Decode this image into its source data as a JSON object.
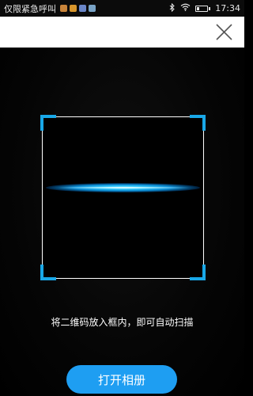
{
  "status_bar": {
    "carrier_text": "仅限紧急呼叫",
    "notification_icons": [
      {
        "name": "app-icon-1",
        "color": "#c8843a"
      },
      {
        "name": "app-icon-2",
        "color": "#d8962c"
      },
      {
        "name": "app-icon-3",
        "color": "#6a86c8"
      },
      {
        "name": "app-icon-4",
        "color": "#79a3c6"
      }
    ],
    "battery_level": 0.25,
    "time": "17:34"
  },
  "scanner": {
    "hint": "将二维码放入框内，即可自动扫描",
    "frame_border_color": "#ffffff",
    "corner_color": "#19a8e8",
    "scan_line_color": "#3fd3ff"
  },
  "actions": {
    "open_album_label": "打开相册",
    "accent_color": "#1e9ef2"
  }
}
